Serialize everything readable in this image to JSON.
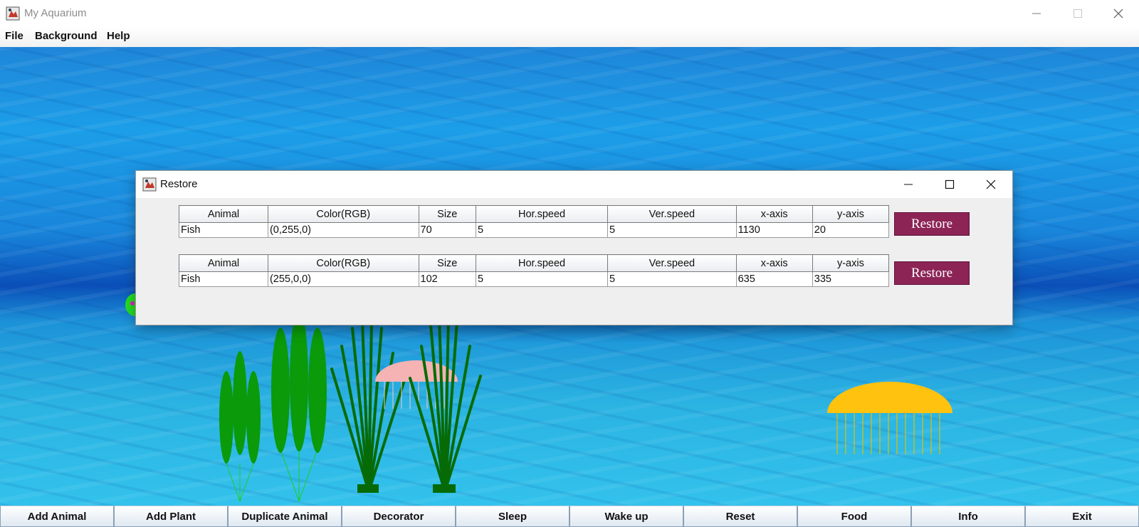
{
  "window": {
    "title": "My Aquarium"
  },
  "menu": {
    "items": [
      "File",
      "Background",
      "Help"
    ]
  },
  "dialog": {
    "title": "Restore",
    "columns": [
      "Animal",
      "Color(RGB)",
      "Size",
      "Hor.speed",
      "Ver.speed",
      "x-axis",
      "y-axis"
    ],
    "records": [
      {
        "values": [
          "Fish",
          "(0,255,0)",
          "70",
          "5",
          "5",
          "1130",
          "20"
        ],
        "button": "Restore"
      },
      {
        "values": [
          "Fish",
          "(255,0,0)",
          "102",
          "5",
          "5",
          "635",
          "335"
        ],
        "button": "Restore"
      }
    ]
  },
  "toolbar": {
    "buttons": [
      "Add Animal",
      "Add Plant",
      "Duplicate Animal",
      "Decorator",
      "Sleep",
      "Wake up",
      "Reset",
      "Food",
      "Info",
      "Exit"
    ]
  },
  "colors": {
    "restore_button": "#8c2456",
    "plant_green": "#0a9a0a",
    "grass_dark": "#066b06",
    "jellyfish_pink": "#f5b3b3",
    "jellyfish_yellow": "#ffc20e"
  }
}
